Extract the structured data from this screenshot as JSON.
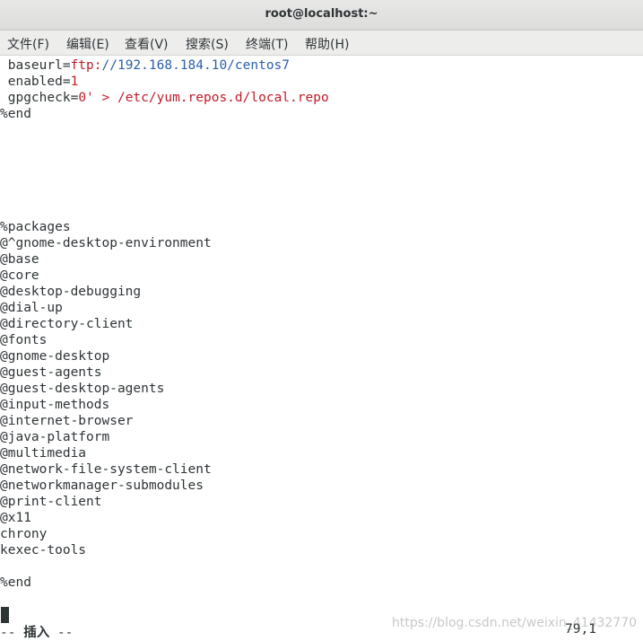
{
  "window": {
    "title": "root@localhost:~"
  },
  "menu": {
    "items": [
      "文件(F)",
      "编辑(E)",
      "查看(V)",
      "搜索(S)",
      "终端(T)",
      "帮助(H)"
    ]
  },
  "editor": {
    "baseurl": {
      "key": " baseurl=",
      "proto": "ftp:",
      "path": "//192.168.184.10/centos7"
    },
    "enabled": {
      "key": " enabled=",
      "value": "1"
    },
    "gpgcheck": {
      "key": " gpgcheck=",
      "value": "0'",
      "redirect": " > /etc/yum.repos.d/local.repo"
    },
    "lines": [
      "%end",
      "%packages",
      "@^gnome-desktop-environment",
      "@base",
      "@core",
      "@desktop-debugging",
      "@dial-up",
      "@directory-client",
      "@fonts",
      "@gnome-desktop",
      "@guest-agents",
      "@guest-desktop-agents",
      "@input-methods",
      "@internet-browser",
      "@java-platform",
      "@multimedia",
      "@network-file-system-client",
      "@networkmanager-submodules",
      "@print-client",
      "@x11",
      "chrony",
      "kexec-tools",
      "%end"
    ]
  },
  "status": {
    "mode_prefix": "-- ",
    "mode_label": "插入",
    "mode_suffix": " --",
    "position": "79,1"
  },
  "watermark": {
    "text": "https://blog.csdn.net/weixin_41432770"
  },
  "colors": {
    "keyword_red": "#c01c28",
    "string_blue": "#2a5fa8"
  }
}
